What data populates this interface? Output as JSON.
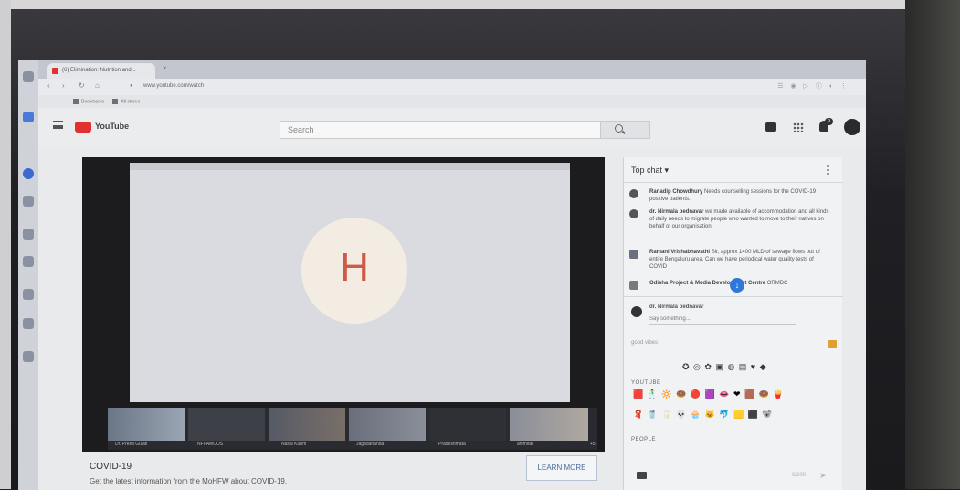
{
  "browser": {
    "tab_title": "(6) Elimination: Nutrition and...",
    "tab_close": "×",
    "url": "www.youtube.com/watch",
    "bookmarks": [
      "Bookmarks",
      "All stores"
    ],
    "nav": {
      "back": "‹",
      "forward": "›",
      "reload": "↻",
      "home": "⌂"
    },
    "ext_icons": "☰ ◉ ▷ ⓘ ◐ ⋮"
  },
  "youtube": {
    "logo_text": "YouTube",
    "search_placeholder": "Search",
    "notification_count": "9"
  },
  "video": {
    "avatar_letter": "H",
    "participants": [
      {
        "name": "Dr. Preeti Gulati"
      },
      {
        "name": "NFI-AMCOS"
      },
      {
        "name": "Nasal Kunm"
      },
      {
        "name": "Jagadananda"
      },
      {
        "name": "Pradeshmata"
      },
      {
        "name": "animitai"
      }
    ],
    "participant_count": "+5"
  },
  "info": {
    "title": "COVID-19",
    "description": "Get the latest information from the MoHFW about COVID-19.",
    "learn_more": "LEARN MORE"
  },
  "chat": {
    "title": "Top chat ▾",
    "messages": [
      {
        "author": "Ranadip Chowdhury",
        "text": "Needs counselling sessions for the COVID-19 positive patients."
      },
      {
        "author": "dr. Nirmala pednavar",
        "text": "we made available of accommodation and all kinds of daily needs to migrate people who wanted to move to their natives on behalf of our organisation."
      },
      {
        "author": "Ramani Vrishabhavathi",
        "text": "Sir, approx 1400 MLD of sewage flows out of entire Bengaluru area. Can we have periodical water quality tests of COVID"
      },
      {
        "author": "Odisha Project & Media Development Centre",
        "text": "ORMDC"
      }
    ],
    "scroll_down": "↓",
    "input_author": "dr. Nirmala pednavar",
    "input_placeholder": "Say something...",
    "emoji_search": "good vibes",
    "emoji_row1": "✪ ◎ ✿ ▣ ◍ ▤ ♥ ◆",
    "emoji_cat_youtube": "YOUTUBE",
    "emoji_row2": "🟥 🕺 🔆 🍩 🔴 🟪 👄 ❤ 🟫 🍩 🍟",
    "emoji_row3": "🧣 🥤 🥛 💀 🧁 🐱 🐬 🟨 ⬛ 🐨",
    "emoji_cat_people": "PEOPLE",
    "char_count": "0/200",
    "send": "➤"
  }
}
